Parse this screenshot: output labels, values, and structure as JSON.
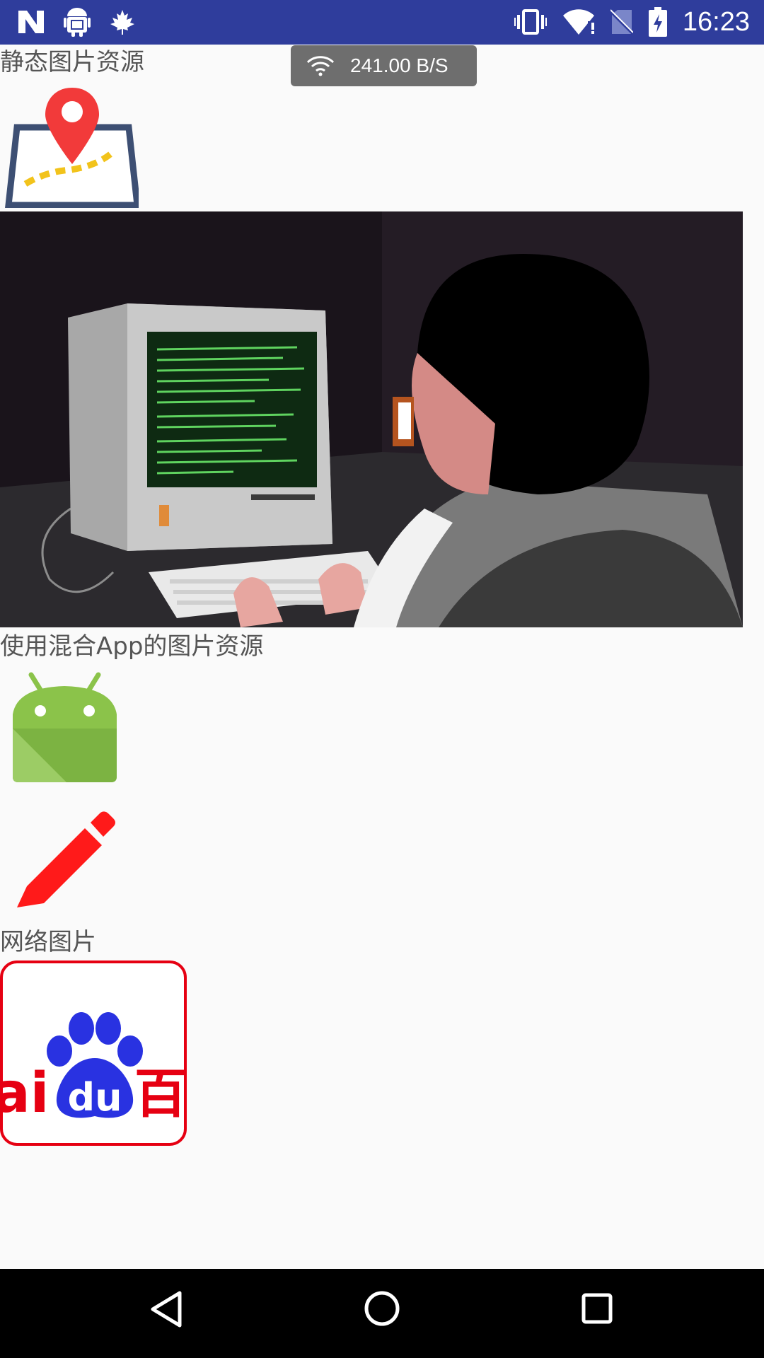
{
  "status_bar": {
    "time": "16:23",
    "icons_left": [
      "n-logo-icon",
      "android-debug-icon",
      "maple-leaf-icon"
    ],
    "icons_right": [
      "vibrate-icon",
      "wifi-icon",
      "no-sim-icon",
      "battery-icon"
    ]
  },
  "toast": {
    "speed": "241.00 B/S",
    "icon": "wifi-icon"
  },
  "sections": {
    "static_title": "静态图片资源",
    "hybrid_title": "使用混合App的图片资源",
    "network_title": "网络图片"
  },
  "images": {
    "map_pin": "map-pin-icon",
    "hacker_gif": "hacker-computer-illustration",
    "android": "android-logo",
    "pencil": "pencil-icon",
    "baidu": "baidu-logo"
  },
  "colors": {
    "status_bar": "#2f3d9c",
    "background": "#fafafa",
    "android_green": "#8bc34a",
    "pencil_red": "#ff1a1a",
    "baidu_blue": "#2932e1",
    "baidu_red": "#e60012"
  }
}
